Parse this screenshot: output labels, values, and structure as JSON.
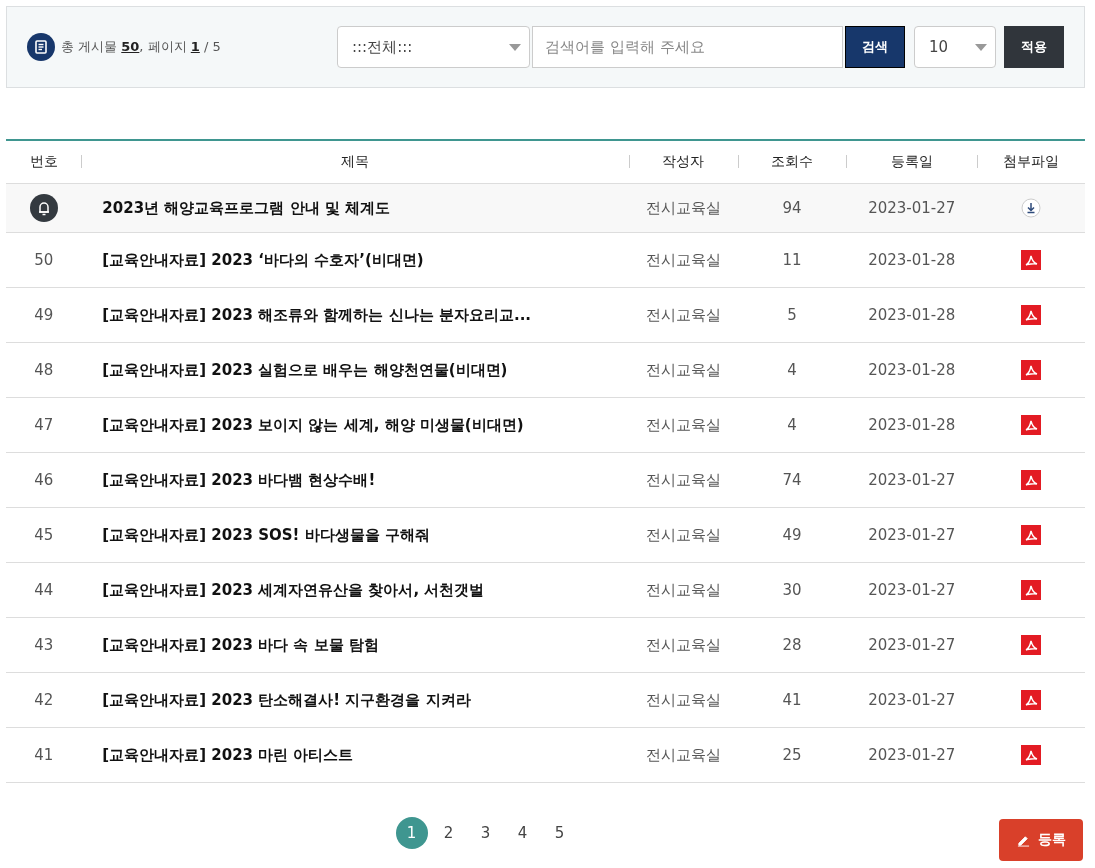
{
  "summary": "총 게시물 **50**, 페이지 **1** / 5",
  "search": {
    "category": ":::전체:::",
    "placeholder": "검색어를 입력해 주세요",
    "button": "검색",
    "page_size": "10",
    "apply": "적용"
  },
  "table": {
    "columns": [
      "번호",
      "제목",
      "작성자",
      "조회수",
      "등록일",
      "첨부파일"
    ],
    "rows": [
      {
        "kind": "notice",
        "title": "2023년 해양교육프로그램 안내 및 체계도",
        "author": "전시교육실",
        "views": "94",
        "date": "2023-01-27",
        "attachment": {
          "kind": "download"
        }
      },
      {
        "kind": "post",
        "number": "50",
        "title": "[교육안내자료] 2023 ‘바다의 수호자’(비대면)",
        "author": "전시교육실",
        "views": "11",
        "date": "2023-01-28",
        "attachment": {
          "kind": "pdf"
        }
      },
      {
        "kind": "post",
        "number": "49",
        "title": "[교육안내자료] 2023 해조류와 함께하는 신나는 분자요리교...",
        "author": "전시교육실",
        "views": "5",
        "date": "2023-01-28",
        "attachment": {
          "kind": "pdf"
        }
      },
      {
        "kind": "post",
        "number": "48",
        "title": "[교육안내자료] 2023 실험으로 배우는 해양천연물(비대면)",
        "author": "전시교육실",
        "views": "4",
        "date": "2023-01-28",
        "attachment": {
          "kind": "pdf"
        }
      },
      {
        "kind": "post",
        "number": "47",
        "title": "[교육안내자료] 2023 보이지 않는 세계, 해양 미생물(비대면)",
        "author": "전시교육실",
        "views": "4",
        "date": "2023-01-28",
        "attachment": {
          "kind": "pdf"
        }
      },
      {
        "kind": "post",
        "number": "46",
        "title": "[교육안내자료] 2023 바다뱀 현상수배!",
        "author": "전시교육실",
        "views": "74",
        "date": "2023-01-27",
        "attachment": {
          "kind": "pdf"
        }
      },
      {
        "kind": "post",
        "number": "45",
        "title": "[교육안내자료] 2023 SOS! 바다생물을 구해줘",
        "author": "전시교육실",
        "views": "49",
        "date": "2023-01-27",
        "attachment": {
          "kind": "pdf"
        }
      },
      {
        "kind": "post",
        "number": "44",
        "title": "[교육안내자료] 2023 세계자연유산을 찾아서, 서천갯벌",
        "author": "전시교육실",
        "views": "30",
        "date": "2023-01-27",
        "attachment": {
          "kind": "pdf"
        }
      },
      {
        "kind": "post",
        "number": "43",
        "title": "[교육안내자료] 2023 바다 속 보물 탐험",
        "author": "전시교육실",
        "views": "28",
        "date": "2023-01-27",
        "attachment": {
          "kind": "pdf"
        }
      },
      {
        "kind": "post",
        "number": "42",
        "title": "[교육안내자료] 2023 탄소해결사! 지구환경을 지켜라",
        "author": "전시교육실",
        "views": "41",
        "date": "2023-01-27",
        "attachment": {
          "kind": "pdf"
        }
      },
      {
        "kind": "post",
        "number": "41",
        "title": "[교육안내자료] 2023 마린 아티스트",
        "author": "전시교육실",
        "views": "25",
        "date": "2023-01-27",
        "attachment": {
          "kind": "pdf"
        }
      }
    ]
  },
  "pagination": [
    {
      "label": "1",
      "selected": true
    },
    {
      "label": "2",
      "selected": false
    },
    {
      "label": "3",
      "selected": false
    },
    {
      "label": "4",
      "selected": false
    },
    {
      "label": "5",
      "selected": false
    }
  ],
  "write_button": "등록"
}
